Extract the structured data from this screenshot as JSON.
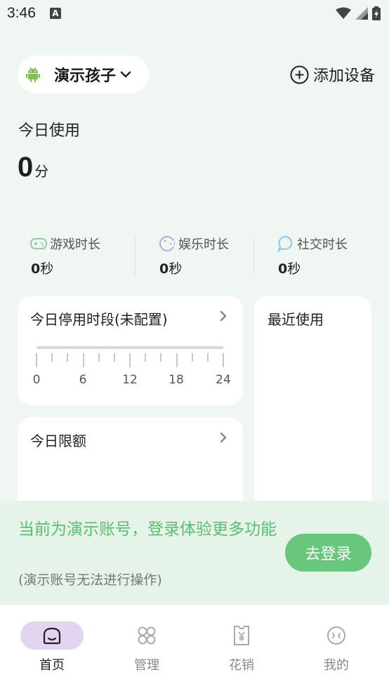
{
  "status": {
    "time": "3:46",
    "notif_letter": "A"
  },
  "header": {
    "device_name": "演示孩子",
    "add_device_label": "添加设备"
  },
  "today": {
    "label": "今日使用",
    "value": "0",
    "unit": "分"
  },
  "stats": [
    {
      "label": "游戏时长",
      "value": "0",
      "unit": "秒",
      "icon": "gamepad-icon",
      "color": "#8fd39b"
    },
    {
      "label": "娱乐时长",
      "value": "0",
      "unit": "秒",
      "icon": "entertainment-icon",
      "color": "#b9a6e6"
    },
    {
      "label": "社交时长",
      "value": "0",
      "unit": "秒",
      "icon": "chat-bubble-icon",
      "color": "#8cc8ef"
    }
  ],
  "downtime_card": {
    "title": "今日停用时段(未配置)",
    "hours": [
      "0",
      "6",
      "12",
      "18",
      "24"
    ]
  },
  "recent_card": {
    "title": "最近使用"
  },
  "limit_card": {
    "title": "今日限额"
  },
  "banner": {
    "text": "当前为演示账号，登录体验更多功能",
    "sub": "(演示账号无法进行操作)",
    "login_label": "去登录"
  },
  "nav": [
    {
      "label": "首页",
      "icon": "home-icon",
      "active": true
    },
    {
      "label": "管理",
      "icon": "grid-icon",
      "active": false
    },
    {
      "label": "花销",
      "icon": "receipt-icon",
      "active": false
    },
    {
      "label": "我的",
      "icon": "profile-icon",
      "active": false
    }
  ],
  "colors": {
    "accent": "#68c77c",
    "banner_bg": "#e6f3e8",
    "nav_active": "#e3d4f0",
    "page_bg": "#f0f6f1"
  }
}
